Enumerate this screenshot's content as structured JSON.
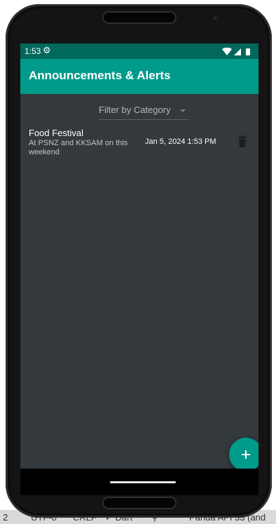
{
  "status_bar": {
    "time": "1:53"
  },
  "app_bar": {
    "title": "Announcements & Alerts"
  },
  "filter": {
    "label": "Filter by Category"
  },
  "announcements": [
    {
      "title": "Food Festival",
      "description": "At PSNZ and KKSAM on this weekend",
      "datetime": "Jan 5, 2024 1:53 PM"
    }
  ],
  "fab": {
    "symbol": "+"
  },
  "ide_status": {
    "line": "2",
    "encoding": "UTF-8",
    "line_sep": "CRLF",
    "indent": "✓ Dart",
    "misc": "⚲",
    "device": "Panda API 33 (and"
  },
  "icons": {
    "status_gear": "settings-gear-icon",
    "status_wifi": "wifi-icon",
    "status_signal": "cell-signal-icon",
    "status_battery": "battery-icon",
    "delete": "trash-icon",
    "fab": "plus-icon"
  },
  "colors": {
    "status_bar": "#00695c",
    "app_bar": "#009b8a",
    "background": "#33393d",
    "fab": "#009b8a",
    "text_primary": "#ffffff",
    "text_secondary": "#c2c6c9"
  }
}
